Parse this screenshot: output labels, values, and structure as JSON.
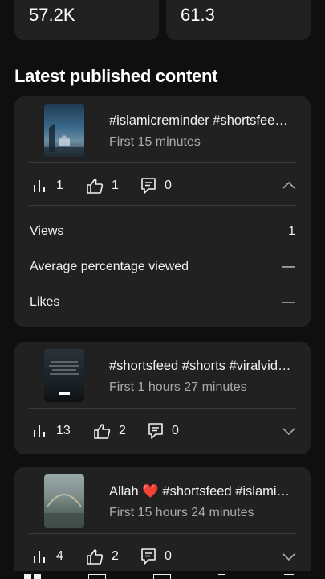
{
  "stats": [
    {
      "value": "57.2K"
    },
    {
      "value": "61.3"
    }
  ],
  "section_title": "Latest published content",
  "items": [
    {
      "title": "#islamicreminder #shortsfeed #shorts #viral",
      "subtitle": "First 15 minutes",
      "views": "1",
      "likes": "1",
      "comments": "0",
      "expanded": true,
      "details": [
        {
          "label": "Views",
          "value": "1"
        },
        {
          "label": "Average percentage viewed",
          "value": "—"
        },
        {
          "label": "Likes",
          "value": "—"
        }
      ]
    },
    {
      "title": "#shortsfeed #shorts #viralvideo #islamic",
      "subtitle": "First 1 hours 27 minutes",
      "views": "13",
      "likes": "2",
      "comments": "0",
      "expanded": false
    },
    {
      "title": "Allah ❤️ #shortsfeed #islamic #shorts",
      "subtitle": "First 15 hours 24 minutes",
      "views": "4",
      "likes": "2",
      "comments": "0",
      "expanded": false
    }
  ],
  "icons": {
    "views": "bar-chart-icon",
    "likes": "thumbs-up-icon",
    "comments": "comment-icon",
    "expand": "chevron-icon"
  },
  "colors": {
    "background": "#0f0f0f",
    "card": "#212121",
    "text_secondary": "#aaaaaa"
  }
}
